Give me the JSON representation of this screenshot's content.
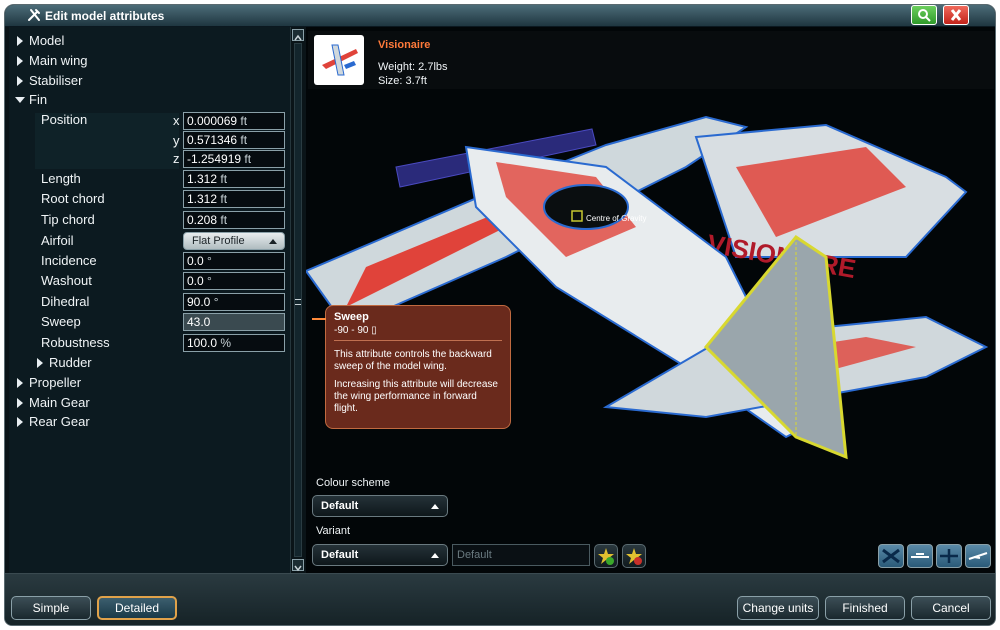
{
  "window": {
    "title": "Edit model attributes"
  },
  "tree": {
    "model": "Model",
    "main_wing": "Main wing",
    "stabiliser": "Stabiliser",
    "fin": "Fin",
    "rudder": "Rudder",
    "propeller": "Propeller",
    "main_gear": "Main Gear",
    "rear_gear": "Rear Gear"
  },
  "attrs": {
    "position": {
      "label": "Position",
      "x_label": "x",
      "y_label": "y",
      "z_label": "z",
      "x": "0.000069",
      "y": "0.571346",
      "z": "-1.254919",
      "unit": "ft"
    },
    "length": {
      "label": "Length",
      "value": "1.312",
      "unit": "ft"
    },
    "root_chord": {
      "label": "Root chord",
      "value": "1.312",
      "unit": "ft"
    },
    "tip_chord": {
      "label": "Tip chord",
      "value": "0.208",
      "unit": "ft"
    },
    "airfoil": {
      "label": "Airfoil",
      "value": "Flat Profile"
    },
    "incidence": {
      "label": "Incidence",
      "value": "0.0",
      "unit": "°"
    },
    "washout": {
      "label": "Washout",
      "value": "0.0",
      "unit": "°"
    },
    "dihedral": {
      "label": "Dihedral",
      "value": "90.0",
      "unit": "°"
    },
    "sweep": {
      "label": "Sweep",
      "value": "43.0"
    },
    "robustness": {
      "label": "Robustness",
      "value": "100.0",
      "unit": "%"
    }
  },
  "model_info": {
    "name": "Visionaire",
    "weight": "Weight: 2.7lbs",
    "size": "Size: 3.7ft"
  },
  "scene": {
    "cg_label": "Centre of Gravity",
    "brand_text": "VISIONAIRE"
  },
  "tooltip": {
    "title": "Sweep",
    "range": "-90 - 90 ▯",
    "text1": "This attribute controls the backward sweep of the model wing.",
    "text2": "Increasing this attribute will decrease the wing performance in forward flight."
  },
  "options": {
    "colour_label": "Colour scheme",
    "colour_value": "Default",
    "variant_label": "Variant",
    "variant_value": "Default",
    "variant_placeholder": "Default"
  },
  "buttons": {
    "simple": "Simple",
    "detailed": "Detailed",
    "change_units": "Change units",
    "finished": "Finished",
    "cancel": "Cancel"
  },
  "colors": {
    "accent_orange": "#ff7a3a",
    "tooltip_bg": "#6a2a1c",
    "active_border": "#e0a24a"
  }
}
